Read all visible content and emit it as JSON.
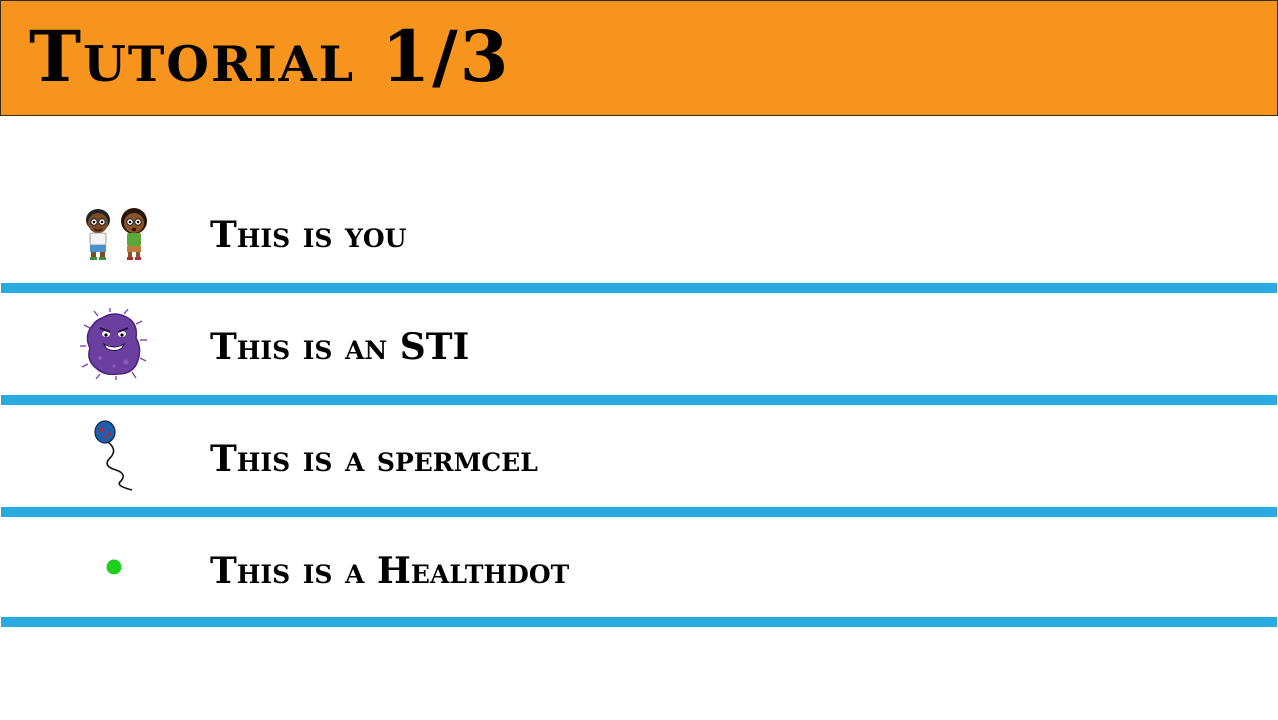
{
  "header": {
    "title": "Tutorial 1/3"
  },
  "items": [
    {
      "label": "This is you",
      "icon": "player-couple-icon"
    },
    {
      "label": "This is an STI",
      "icon": "sti-germ-icon"
    },
    {
      "label": "This is a spermcel",
      "icon": "sperm-cell-icon"
    },
    {
      "label": "This is a Healthdot",
      "icon": "healthdot-icon"
    }
  ],
  "colors": {
    "header_background": "#f7941d",
    "divider": "#29abe2",
    "healthdot": "#1ecf1e",
    "sti_germ": "#6a3fa0",
    "sperm_head": "#1c5fa8"
  }
}
